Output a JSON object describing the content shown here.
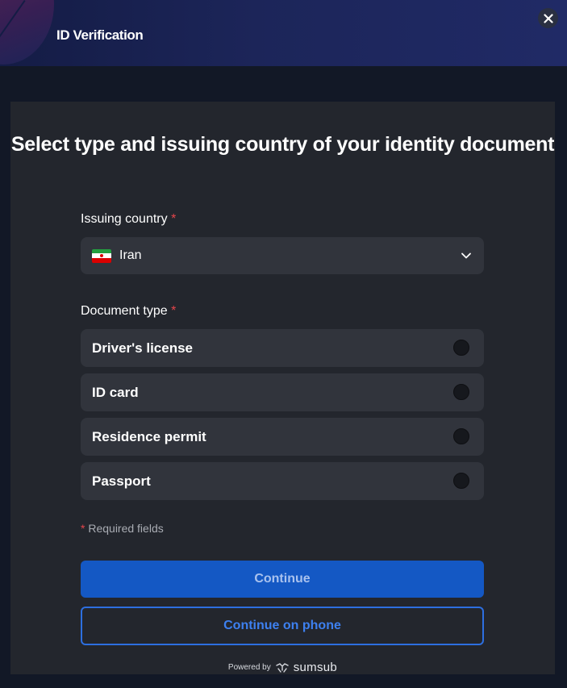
{
  "header": {
    "title": "ID Verification",
    "close_icon": "close-icon"
  },
  "form": {
    "title": "Select type and issuing country of your identity document",
    "country_label": "Issuing country",
    "required_mark": "*",
    "country": {
      "value": "Iran",
      "flag_icon": "iran-flag-icon"
    },
    "document_type_label": "Document type",
    "document_types": [
      {
        "label": "Driver's license",
        "selected": false
      },
      {
        "label": "ID card",
        "selected": false
      },
      {
        "label": "Residence permit",
        "selected": false
      },
      {
        "label": "Passport",
        "selected": false
      }
    ],
    "required_note": "Required fields",
    "continue_label": "Continue",
    "continue_phone_label": "Continue on phone"
  },
  "footer": {
    "powered_by": "Powered by",
    "brand": "sumsub"
  },
  "colors": {
    "accent": "#1458c4",
    "required": "#e5454b",
    "panel": "#23262d",
    "option_bg": "#31343c"
  }
}
